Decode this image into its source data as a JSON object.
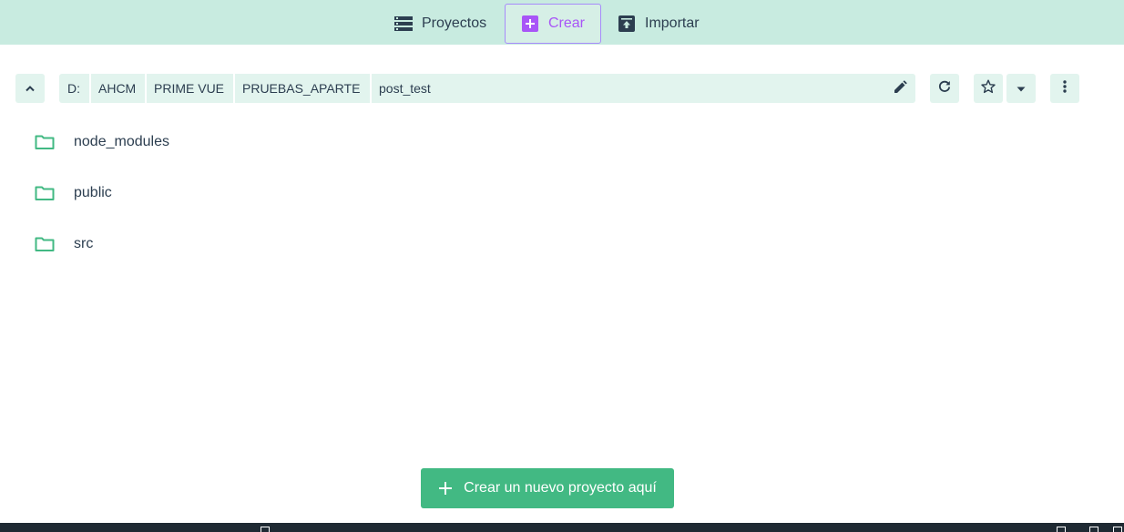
{
  "nav": {
    "tabs": [
      {
        "label": "Proyectos",
        "icon": "list-icon"
      },
      {
        "label": "Crear",
        "icon": "plus-square-icon",
        "active": true
      },
      {
        "label": "Importar",
        "icon": "unarchive-icon"
      }
    ]
  },
  "path": {
    "crumbs": [
      "D:",
      "AHCM",
      "PRIME VUE",
      "PRUEBAS_APARTE",
      "post_test"
    ]
  },
  "folders": [
    {
      "name": "node_modules"
    },
    {
      "name": "public"
    },
    {
      "name": "src"
    }
  ],
  "actions": {
    "create_here_label": "Crear un nuevo proyecto aquí"
  },
  "colors": {
    "accent": "#42b983",
    "nav_bg": "#c8ebe0",
    "active_tab": "#a855f7",
    "text": "#2c3e50"
  }
}
